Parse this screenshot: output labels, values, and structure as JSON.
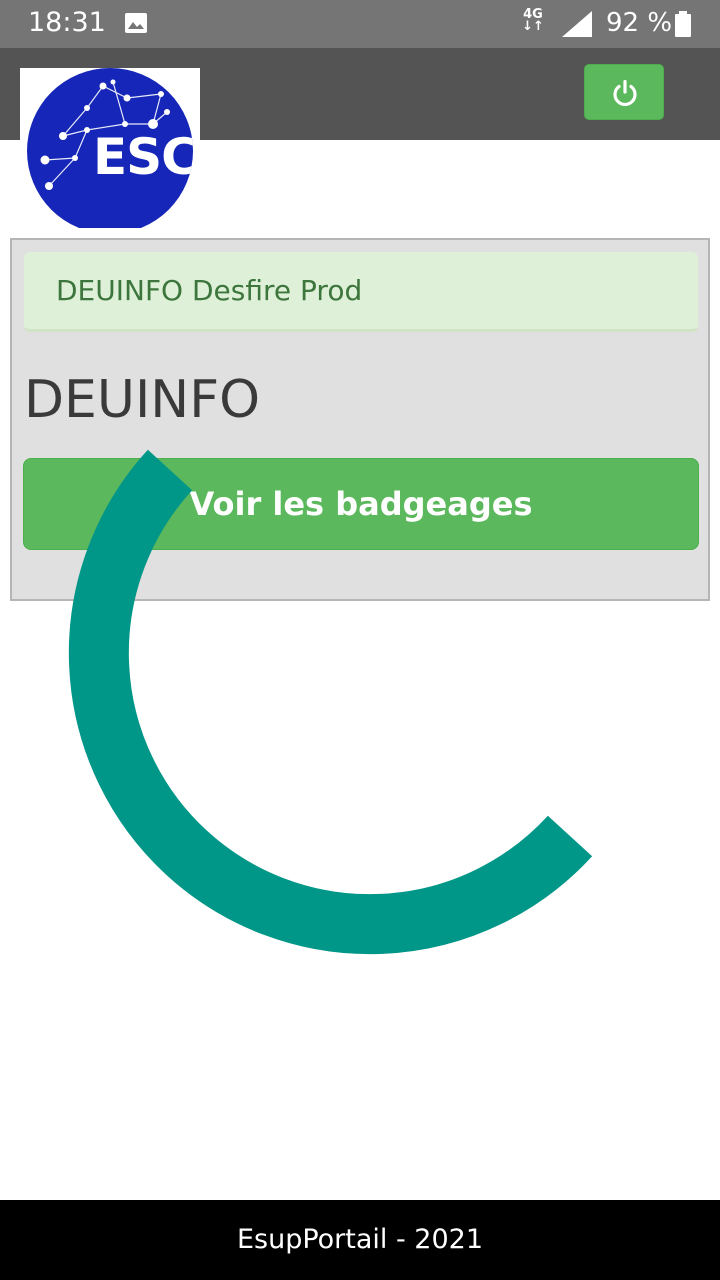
{
  "status_bar": {
    "time": "18:31",
    "network": "4G",
    "battery": "92 %",
    "icons": [
      "photo-icon",
      "signal-icon",
      "battery-icon"
    ]
  },
  "app_bar": {
    "logo_text": "ESC",
    "power_icon": "power-icon",
    "colors": {
      "bar": "#545454",
      "button": "#5cb85c",
      "logo": "#1526b8"
    }
  },
  "panel": {
    "alert_text": "DEUINFO Desfire Prod",
    "heading": "DEUINFO",
    "button_label": "Voir les badgeages"
  },
  "spinner": {
    "color": "#009688"
  },
  "footer": {
    "text": "EsupPortail - 2021"
  }
}
